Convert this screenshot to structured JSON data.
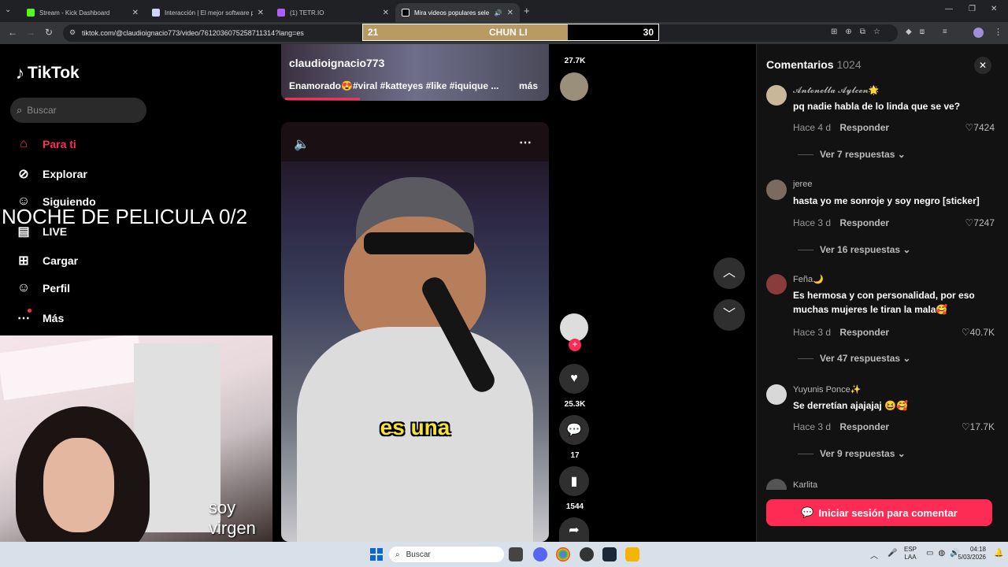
{
  "browser": {
    "tabs": [
      {
        "label": "Stream - Kick Dashboard",
        "color": "#53fc18"
      },
      {
        "label": "Interacción | El mejor software p",
        "color": "#cfd3ff"
      },
      {
        "label": "(1) TETR.IO",
        "color": "#b05cff"
      },
      {
        "label": "Mira videos populares sele",
        "color": "#ffffff"
      }
    ],
    "url": "tiktok.com/@claudioignacio773/video/7612036075258711314?lang=es"
  },
  "overlay": {
    "left_value": "21",
    "name": "CHUN LI",
    "right_value": "30"
  },
  "tiktok": {
    "logo": "TikTok",
    "search_placeholder": "Buscar",
    "nav": [
      {
        "label": "Para ti",
        "icon": "home-icon"
      },
      {
        "label": "Explorar",
        "icon": "compass-icon"
      },
      {
        "label": "Siguiendo",
        "icon": "user-icon"
      },
      {
        "label": "LIVE",
        "icon": "live-icon"
      },
      {
        "label": "Cargar",
        "icon": "plus-icon"
      },
      {
        "label": "Perfil",
        "icon": "profile-icon"
      },
      {
        "label": "Más",
        "icon": "more-icon"
      }
    ],
    "prev_video": {
      "author": "claudioignacio773",
      "caption": "Enamorado😍#viral #katteyes #like #iquique ...",
      "more": "más",
      "count": "27.7K"
    },
    "video": {
      "subtitle": "es una"
    },
    "rail": {
      "likes": "25.3K",
      "comments": "17",
      "saves": "1544"
    }
  },
  "stream_overlay": {
    "title": "NOCHE DE PELICULA 0/2",
    "caption": "soy virgen"
  },
  "comments": {
    "title": "Comentarios",
    "count": "1024",
    "items": [
      {
        "user": "𝓐𝓷𝓽𝓸𝓷𝓮𝓵𝓵𝓪 𝓐𝔂𝓵𝓬𝓮𝓷🌟",
        "text": "pq nadie habla de lo linda que se ve?",
        "time": "Hace 4 d",
        "reply": "Responder",
        "likes": "7424",
        "replies": "Ver 7 respuestas",
        "avatar": "#c9b79a"
      },
      {
        "user": "jeree",
        "text": "hasta yo me sonroje y soy negro [sticker]",
        "time": "Hace 3 d",
        "reply": "Responder",
        "likes": "7247",
        "replies": "Ver 16 respuestas",
        "avatar": "#7a6a5f"
      },
      {
        "user": "Feña🌙",
        "text": "Es hermosa y con personalidad, por eso muchas mujeres le tiran la mala🥰",
        "time": "Hace 3 d",
        "reply": "Responder",
        "likes": "40.7K",
        "replies": "Ver 47 respuestas",
        "avatar": "#8a3b3b"
      },
      {
        "user": "Yuyunis Ponce✨",
        "text": "Se derretían ajajajaj 😆🥰",
        "time": "Hace 3 d",
        "reply": "Responder",
        "likes": "17.7K",
        "replies": "Ver 9 respuestas",
        "avatar": "#d8d8d8"
      },
      {
        "user": "Karlita",
        "avatar": "#555"
      }
    ],
    "login_button": "Iniciar sesión para comentar"
  },
  "taskbar": {
    "search": "Buscar",
    "lang1": "ESP",
    "lang2": "LAA",
    "time": "04:18",
    "date": "5/03/2026"
  }
}
